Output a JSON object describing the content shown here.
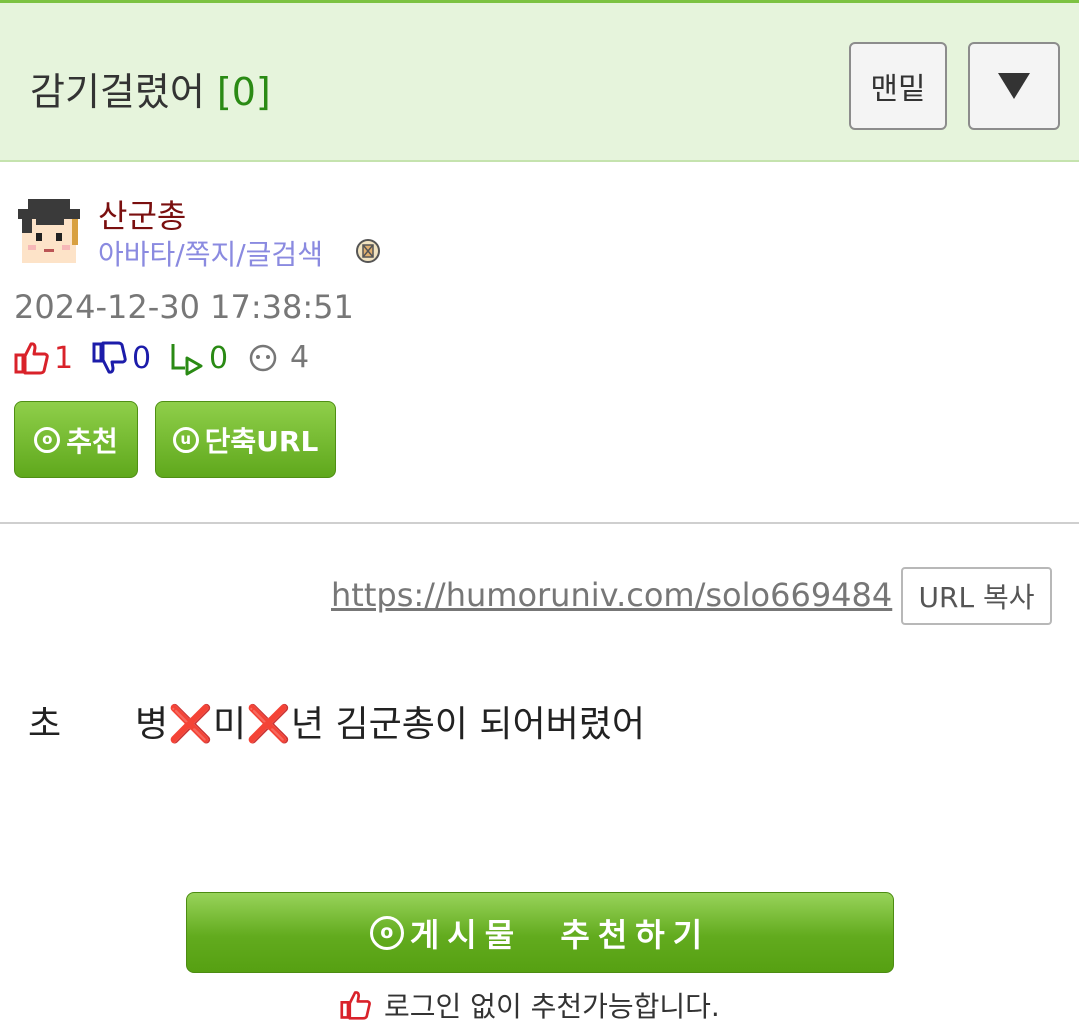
{
  "header": {
    "title": "감기걸렸어",
    "comment_count": "[0]",
    "bottom_button_label": "맨밑"
  },
  "author": {
    "nickname": "산군총",
    "links": "아바타/쪽지/글검색"
  },
  "post": {
    "date": "2024-12-30 17:38:51",
    "stats": {
      "recommend": "1",
      "oppose": "0",
      "share": "0",
      "views": "4"
    },
    "recommend_button_label": "추천",
    "short_url_button_label": "단축URL",
    "short_url": "https://humoruniv.com/solo669484",
    "url_copy_label": "URL 복사",
    "body_part1": "초",
    "body_part2": "병❌미❌년 김군총이 되어버렸어"
  },
  "footer": {
    "big_recommend_label": "게시물  추천하기",
    "login_note": "로그인 없이 추천가능합니다."
  },
  "colors": {
    "header_bg": "#e6f4dc",
    "accent_green": "#62ab1e",
    "nickname": "#7a0f0f",
    "links": "#8a8ae0",
    "up_red": "#d9222a",
    "down_blue": "#1c1caa",
    "share_green": "#2a8a14"
  }
}
